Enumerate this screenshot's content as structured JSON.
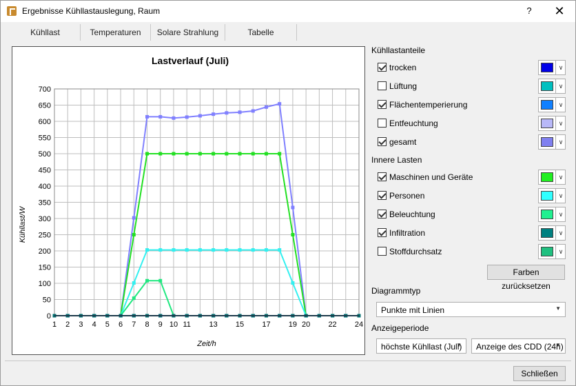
{
  "window": {
    "title": "Ergebnisse Kühllastauslegung, Raum",
    "help": "?",
    "close": "✕"
  },
  "tabs": [
    {
      "label": "Kühllast",
      "active": true
    },
    {
      "label": "Temperaturen",
      "active": false
    },
    {
      "label": "Solare Strahlung",
      "active": false
    },
    {
      "label": "Tabelle",
      "active": false
    }
  ],
  "chart_data": {
    "type": "line",
    "title": "Lastverlauf (Juli)",
    "xlabel": "Zeit/h",
    "ylabel": "Kühllast/W",
    "xlim": [
      1,
      24
    ],
    "ylim": [
      0,
      700
    ],
    "x_ticks": [
      "1",
      "2",
      "3",
      "4",
      "5",
      "6",
      "7",
      "8",
      "9",
      "10",
      "11",
      "13",
      "15",
      "17",
      "19",
      "20",
      "22",
      "24"
    ],
    "y_ticks": [
      "0",
      "50",
      "100",
      "150",
      "200",
      "250",
      "300",
      "350",
      "400",
      "450",
      "500",
      "550",
      "600",
      "650",
      "700"
    ],
    "grid": true,
    "x": [
      1,
      2,
      3,
      4,
      5,
      6,
      7,
      8,
      9,
      10,
      11,
      12,
      13,
      14,
      15,
      16,
      17,
      18,
      19,
      20,
      21,
      22,
      23,
      24
    ],
    "series": [
      {
        "name": "gesamt",
        "color": "#8080ff",
        "values": [
          0,
          0,
          0,
          0,
          0,
          0,
          302,
          614,
          614,
          610,
          613,
          617,
          622,
          626,
          628,
          632,
          644,
          654,
          334,
          0,
          0,
          0,
          0,
          0
        ]
      },
      {
        "name": "Maschinen und Geräte",
        "color": "#22e022",
        "values": [
          0,
          0,
          0,
          0,
          0,
          0,
          250,
          500,
          500,
          500,
          500,
          500,
          500,
          500,
          500,
          500,
          500,
          500,
          250,
          0,
          0,
          0,
          0,
          0
        ]
      },
      {
        "name": "Personen",
        "color": "#33f0f0",
        "values": [
          0,
          0,
          0,
          0,
          0,
          0,
          101,
          203,
          203,
          203,
          203,
          203,
          203,
          203,
          203,
          203,
          203,
          203,
          101,
          0,
          0,
          0,
          0,
          0
        ]
      },
      {
        "name": "Beleuchtung",
        "color": "#20e880",
        "values": [
          0,
          0,
          0,
          0,
          0,
          0,
          54,
          108,
          108,
          0,
          0,
          0,
          0,
          0,
          0,
          0,
          0,
          0,
          0,
          0,
          0,
          0,
          0,
          0
        ]
      },
      {
        "name": "trocken",
        "color": "#0000e0",
        "values": [
          0,
          0,
          0,
          0,
          0,
          0,
          0,
          0,
          0,
          0,
          0,
          0,
          0,
          0,
          0,
          0,
          0,
          0,
          0,
          0,
          0,
          0,
          0,
          0
        ]
      },
      {
        "name": "Flächentemperierung",
        "color": "#1080ff",
        "values": [
          0,
          0,
          0,
          0,
          0,
          0,
          0,
          0,
          0,
          0,
          0,
          0,
          0,
          0,
          0,
          0,
          0,
          0,
          0,
          0,
          0,
          0,
          0,
          0
        ]
      },
      {
        "name": "Infiltration",
        "color": "#006f6f",
        "values": [
          0,
          0,
          0,
          0,
          0,
          0,
          0,
          0,
          0,
          0,
          0,
          0,
          0,
          0,
          0,
          0,
          0,
          0,
          0,
          0,
          0,
          0,
          0,
          0
        ]
      }
    ]
  },
  "panel": {
    "kuehllast_header": "Kühllastanteile",
    "kuehllast_items": [
      {
        "label": "trocken",
        "checked": true,
        "color": "#0000e8"
      },
      {
        "label": "Lüftung",
        "checked": false,
        "color": "#00c0c0"
      },
      {
        "label": "Flächentemperierung",
        "checked": true,
        "color": "#1080ff"
      },
      {
        "label": "Entfeuchtung",
        "checked": false,
        "color": "#b8b8f8"
      },
      {
        "label": "gesamt",
        "checked": true,
        "color": "#8080f0"
      }
    ],
    "innere_header": "Innere Lasten",
    "innere_items": [
      {
        "label": "Maschinen und Geräte",
        "checked": true,
        "color": "#20f020"
      },
      {
        "label": "Personen",
        "checked": true,
        "color": "#30ffff"
      },
      {
        "label": "Beleuchtung",
        "checked": true,
        "color": "#20f090"
      },
      {
        "label": "Infiltration",
        "checked": true,
        "color": "#008080"
      },
      {
        "label": "Stoffdurchsatz",
        "checked": false,
        "color": "#20c080"
      }
    ],
    "reset_colors": "Farben zurücksetzen",
    "diagramtyp_label": "Diagrammtyp",
    "diagramtyp_value": "Punkte mit Linien",
    "anzeige_label": "Anzeigeperiode",
    "period_value": "höchste Kühllast (Juli)",
    "cdd_value": "Anzeige des CDD (24h)"
  },
  "footer": {
    "close_label": "Schließen"
  }
}
